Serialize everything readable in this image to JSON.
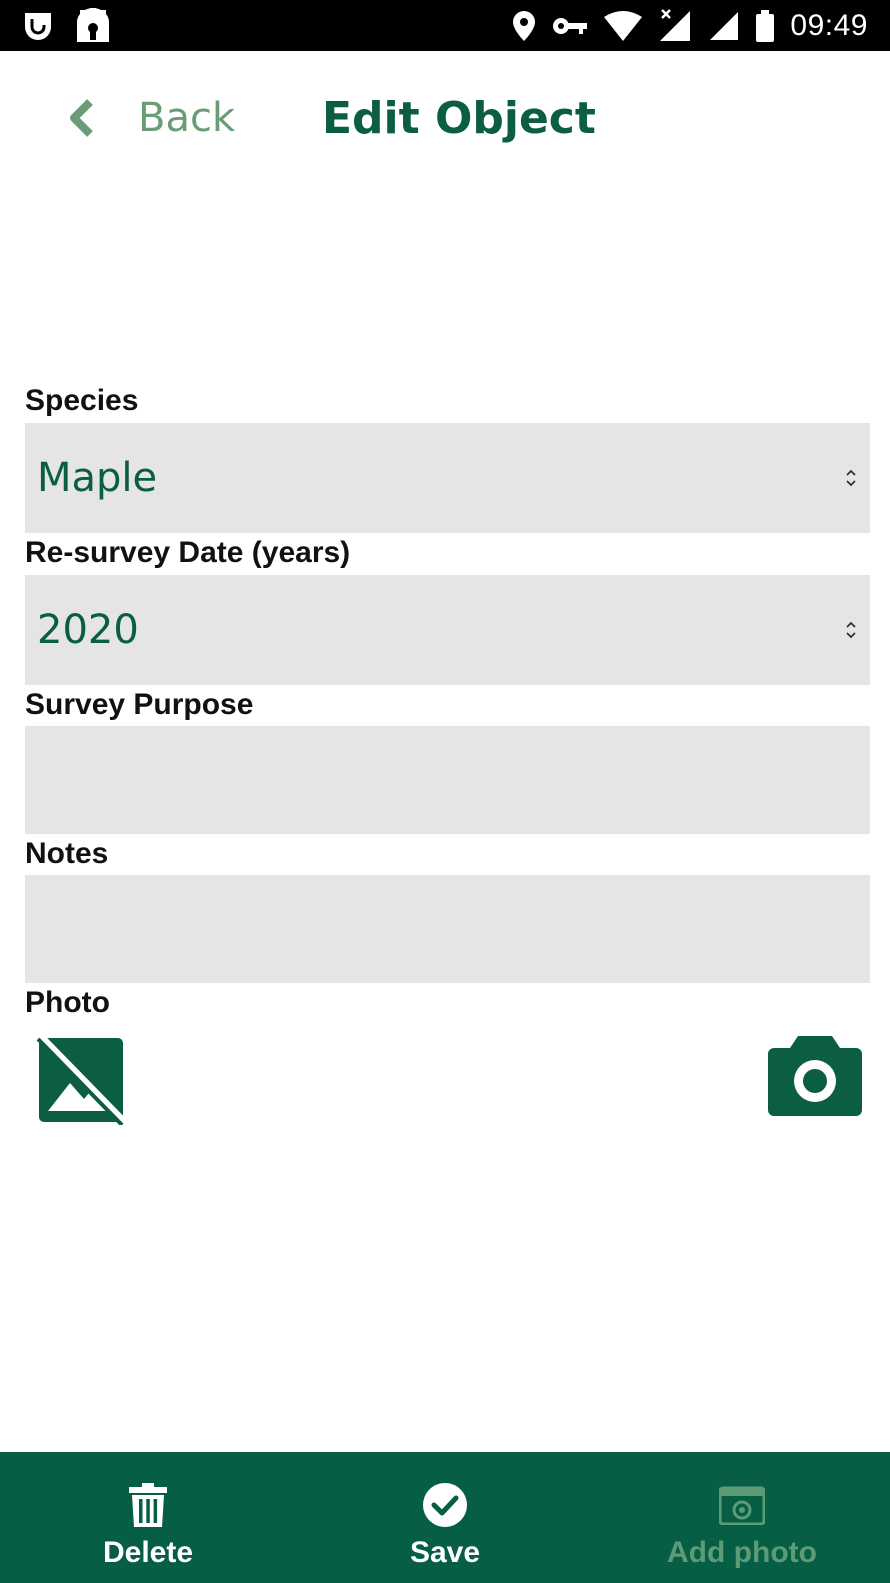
{
  "status_bar": {
    "time": "09:49"
  },
  "header": {
    "back_label": "Back",
    "title": "Edit Object"
  },
  "form": {
    "species": {
      "label": "Species",
      "value": "Maple"
    },
    "resurvey": {
      "label": "Re-survey Date (years)",
      "value": "2020"
    },
    "purpose": {
      "label": "Survey Purpose",
      "value": ""
    },
    "notes": {
      "label": "Notes",
      "value": ""
    },
    "photo": {
      "label": "Photo"
    }
  },
  "bottom_bar": {
    "delete_label": "Delete",
    "save_label": "Save",
    "add_photo_label": "Add photo"
  },
  "colors": {
    "brand_green": "#0b5e40",
    "back_green": "#6a9c75",
    "bottom_bar": "#065f45",
    "field_bg": "#e5e5e5",
    "disabled_green": "#5c9b76"
  }
}
